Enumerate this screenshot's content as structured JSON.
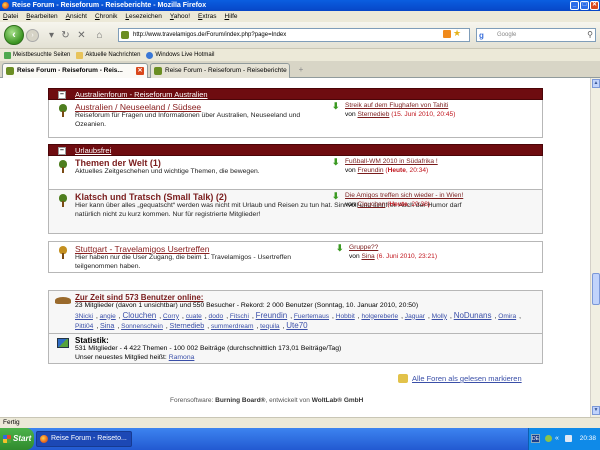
{
  "window": {
    "title": "Reise Forum - Reiseforum - Reiseberichte - Mozilla Firefox"
  },
  "menu": [
    "Datei",
    "Bearbeiten",
    "Ansicht",
    "Chronik",
    "Lesezeichen",
    "Yahoo!",
    "Extras",
    "Hilfe"
  ],
  "nav": {
    "url": "http://www.travelamigos.de/Forum/index.php?page=Index",
    "search_placeholder": "Google"
  },
  "bookmarks": [
    "Meistbesuchte Seiten",
    "Aktuelle Nachrichten",
    "Windows Live Hotmail"
  ],
  "tabs": [
    {
      "label": "Reise Forum - Reiseforum - Reis..."
    },
    {
      "label": "Reise Forum - Reiseforum - Reiseberichte"
    }
  ],
  "categories": [
    {
      "title": "Australienforum - Reiseforum Australien",
      "forums": [
        {
          "title": "Australien / Neuseeland / Südsee",
          "desc": "Reiseforum für Fragen und Informationen über Australien, Neuseeland und Ozeanien.",
          "last_title": "Streik auf dem Flughafen von Tahiti",
          "last_by": "von",
          "last_author": "Sternedieb",
          "last_date": "(15. Juni 2010, 20:45)"
        }
      ]
    },
    {
      "title": "Urlaubsfrei",
      "forums": [
        {
          "title": "Themen der Welt (1)",
          "desc": "Aktuelles Zeitgeschehen und wichtige Themen, die bewegen.",
          "last_title": "Fußball-WM 2010 in Südafrika !",
          "last_by": "von",
          "last_author": "Freundin",
          "last_date_bold": "Heute",
          "last_date_rest": ", 20:34)"
        },
        {
          "title": "Klatsch und Tratsch (Small Talk) (2)",
          "desc": "Hier kann über alles „gequatscht“ werden was nicht mit Urlaub und Reisen zu tun hat. Sinnvoll und sinnfrei. Auch der Humor darf natürlich nicht zu kurz kommen. Nur für registrierte Mitglieder!",
          "last_title": "Die Amigos treffen sich wieder - in Wien!",
          "last_by": "von",
          "last_author": "Clouchen",
          "last_date_bold": "Heute",
          "last_date_rest": ", 20:38)"
        }
      ]
    }
  ],
  "standalone_forum": {
    "title": "Stuttgart - Travelamigos Usertreffen",
    "desc": "Hier haben nur die User Zugang, die beim 1. Travelamigos - Usertreffen teilgenommen haben.",
    "last_title": "Gruppe??",
    "last_by": "von",
    "last_author": "Sina",
    "last_date": "(6. Juni 2010, 23:21)"
  },
  "online": {
    "title": "Zur Zeit sind 573 Benutzer online:",
    "summary": "23 Mitglieder (davon 1 unsichtbar) und 550 Besucher - Rekord: 2 000 Benutzer (Sonntag, 10. Januar 2010, 20:50)",
    "members": [
      {
        "name": "3Nicki",
        "size": "sm"
      },
      {
        "name": "angie",
        "size": "sm"
      },
      {
        "name": "Clouchen",
        "size": "lg"
      },
      {
        "name": "Corry",
        "size": "sm"
      },
      {
        "name": "cuate",
        "size": "sm"
      },
      {
        "name": "dodo",
        "size": "sm"
      },
      {
        "name": "Fitschi",
        "size": "sm"
      },
      {
        "name": "Freundin",
        "size": "lg"
      },
      {
        "name": "Fuertemaus",
        "size": "sm"
      },
      {
        "name": "Hobbit",
        "size": "sm"
      },
      {
        "name": "holgereberle",
        "size": "sm"
      },
      {
        "name": "Jaguar",
        "size": "sm"
      },
      {
        "name": "Molly",
        "size": "sm"
      },
      {
        "name": "NoDunans",
        "size": "lg"
      },
      {
        "name": "Omira",
        "size": "sm"
      },
      {
        "name": "Pitti04",
        "size": "sm"
      },
      {
        "name": "Sina",
        "size": "md"
      },
      {
        "name": "Sonnenschein",
        "size": "sm"
      },
      {
        "name": "Sternedieb",
        "size": "md"
      },
      {
        "name": "summerdream",
        "size": "sm"
      },
      {
        "name": "tequila",
        "size": "sm"
      },
      {
        "name": "Ute70",
        "size": "lg"
      }
    ]
  },
  "stats": {
    "title": "Statistik:",
    "line1": "531 Mitglieder - 4 422 Themen - 100 002 Beiträge (durchschnittlich 173,01 Beiträge/Tag)",
    "line2_prefix": "Unser neuestes Mitglied heißt:",
    "newest_member": "Ramona"
  },
  "actions": {
    "mark_read": "Alle Foren als gelesen markieren"
  },
  "footer": {
    "prefix": "Forensoftware:",
    "product": "Burning Board®",
    "middle": ", entwickelt von",
    "company": "WoltLab® GmbH"
  },
  "status": {
    "text": "Fertig"
  },
  "taskbar": {
    "start": "Start",
    "item": "Reise Forum - Reiseto...",
    "lang": "DE",
    "clock": "20:38"
  }
}
